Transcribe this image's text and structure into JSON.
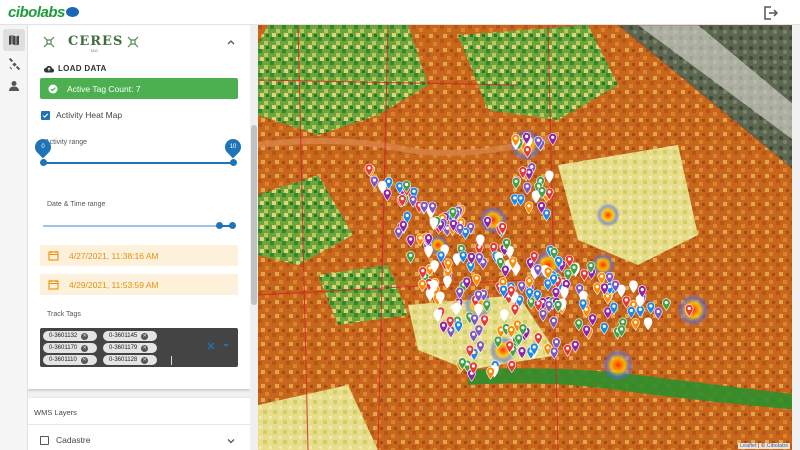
{
  "app": {
    "logo_text": "cibolabs",
    "colors": {
      "brand_green": "#1e9b3b",
      "accent_blue": "#1f73b7",
      "success_green": "#4caf50",
      "date_orange": "#e8900e"
    }
  },
  "rail": {
    "items": [
      {
        "name": "map-icon",
        "active": true
      },
      {
        "name": "satellite-icon",
        "active": false
      },
      {
        "name": "person-icon",
        "active": false
      }
    ]
  },
  "ceres": {
    "title": "CERES",
    "subtitle": "TAG"
  },
  "load": {
    "label": "LOAD DATA",
    "active_tag_count": "Active Tag Count: 7"
  },
  "heatmap": {
    "label": "Activity Heat Map",
    "checked": true
  },
  "activity_range": {
    "label": "Activity range",
    "min": "0",
    "max": "10"
  },
  "date_range": {
    "label": "Date & Time range",
    "start": "4/27/2021, 11:38:16 AM",
    "end": "4/29/2021, 11:53:59 AM"
  },
  "track_tags": {
    "label": "Track Tags",
    "chips": [
      "0-3601132",
      "0-3601145",
      "0-3601170",
      "0-3601179",
      "0-3601110",
      "0-3601128"
    ]
  },
  "wms": {
    "label": "WMS Layers",
    "layers": [
      {
        "label": "Cadastre",
        "checked": false
      }
    ]
  },
  "map": {
    "attribution_leaflet": "Leaflet",
    "attribution_sep": " | © ",
    "attribution_owner": "Cibolabs",
    "pin_colors": [
      "#e53935",
      "#fb8c00",
      "#43a047",
      "#1e88e5",
      "#8e24aa",
      "#7e57c2",
      "#ffffff"
    ]
  }
}
